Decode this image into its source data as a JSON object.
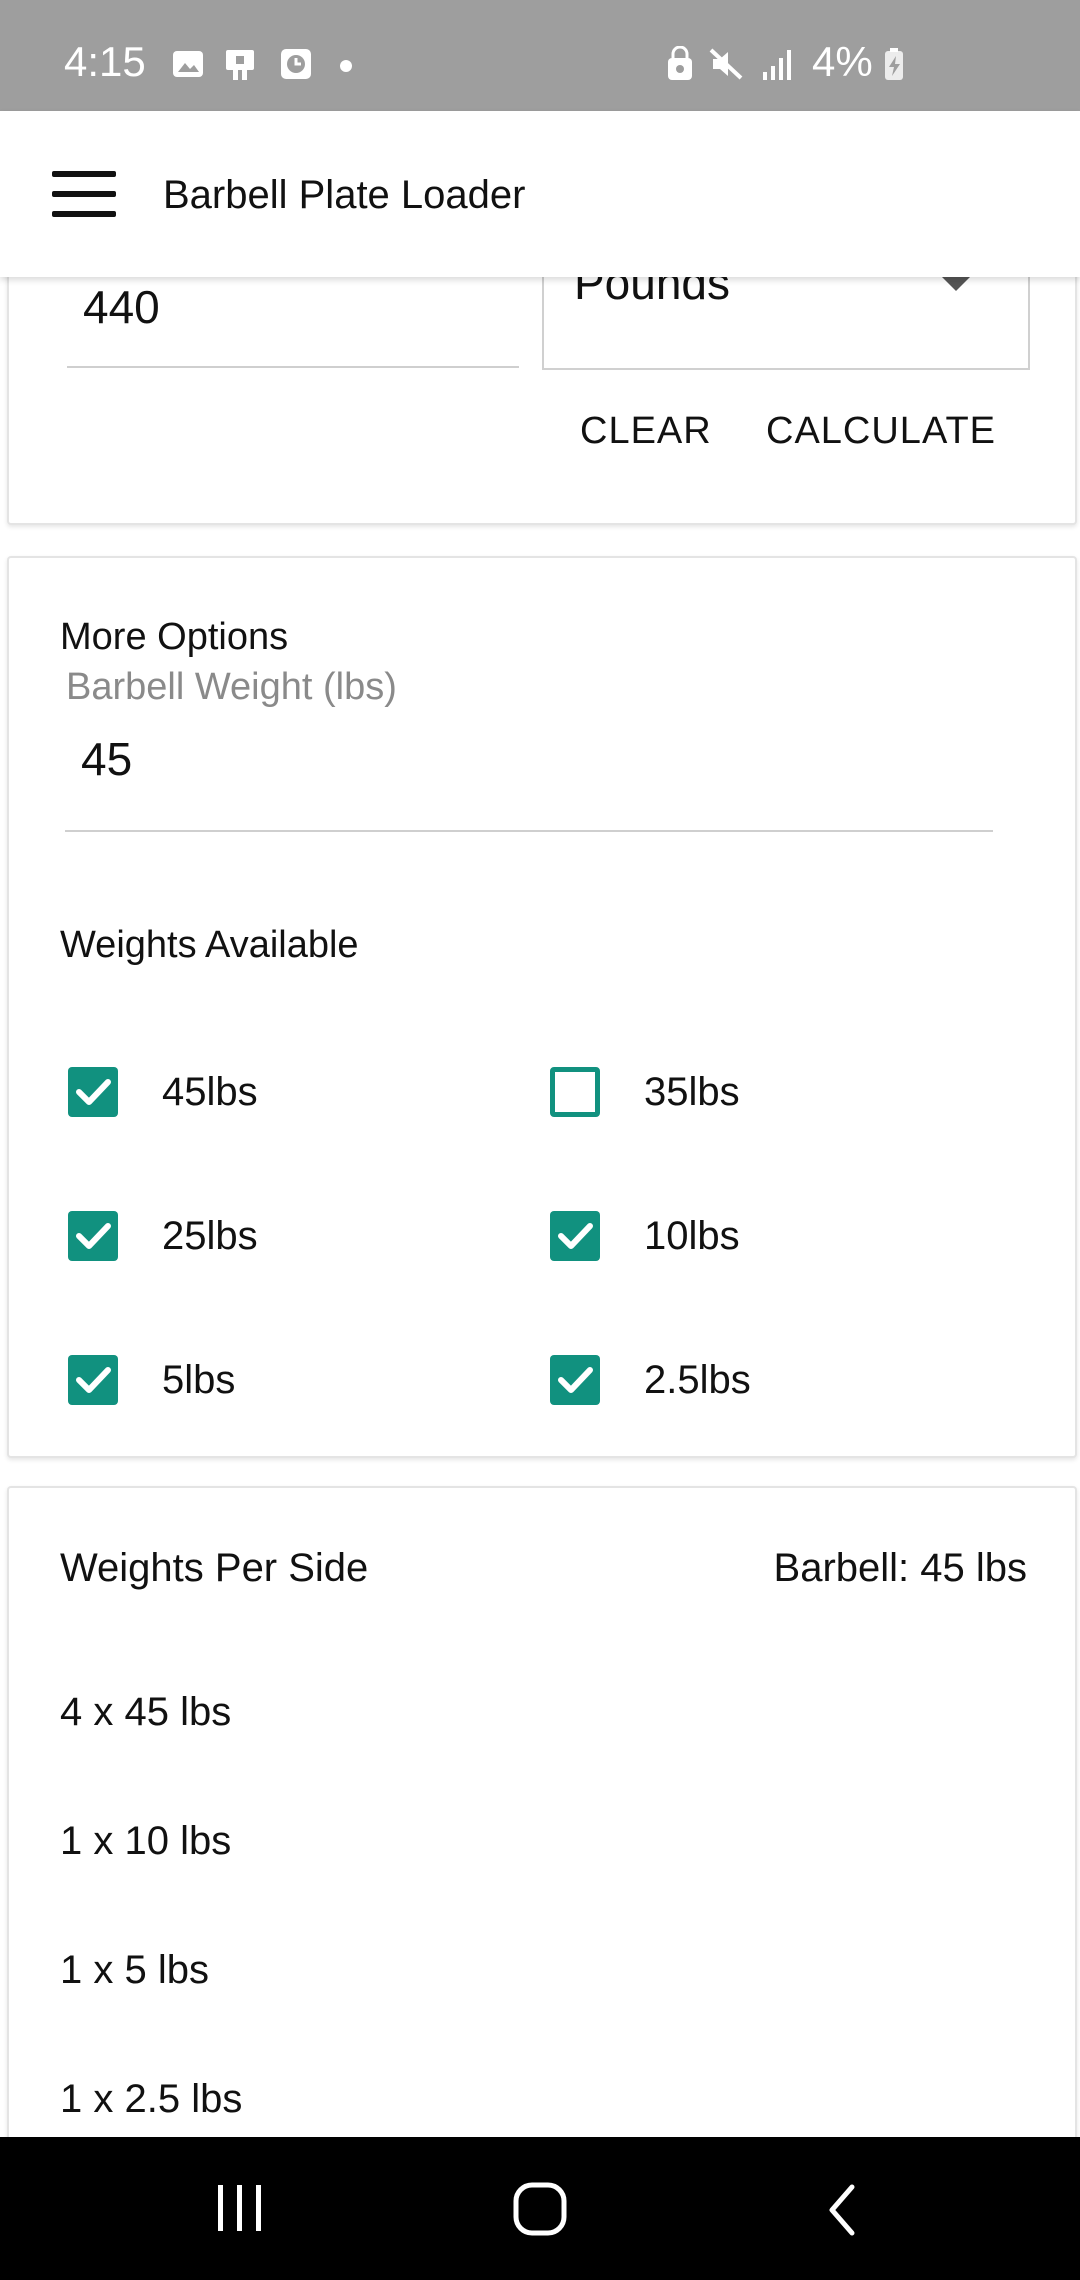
{
  "status_bar": {
    "time": "4:15",
    "battery_percent": "4%",
    "icons": [
      "gallery-icon",
      "device-icon",
      "clock-icon",
      "lock-icon",
      "mute-icon",
      "signal-icon",
      "battery-charging-icon"
    ]
  },
  "app_bar": {
    "title": "Barbell Plate Loader",
    "menu_icon": "hamburger-menu-icon"
  },
  "calculator": {
    "target_weight_value": "440",
    "unit_selected": "Pounds",
    "clear_label": "CLEAR",
    "calculate_label": "CALCULATE"
  },
  "options": {
    "heading": "More Options",
    "barbell_weight_label": "Barbell Weight (lbs)",
    "barbell_weight_value": "45",
    "weights_heading": "Weights Available",
    "weights": [
      {
        "label": "45lbs",
        "checked": true
      },
      {
        "label": "35lbs",
        "checked": false
      },
      {
        "label": "25lbs",
        "checked": true
      },
      {
        "label": "10lbs",
        "checked": true
      },
      {
        "label": "5lbs",
        "checked": true
      },
      {
        "label": "2.5lbs",
        "checked": true
      }
    ]
  },
  "results": {
    "heading": "Weights Per Side",
    "barbell_summary": "Barbell: 45 lbs",
    "plates": [
      "4 x 45 lbs",
      "1 x 10 lbs",
      "1 x 5 lbs",
      "1 x 2.5 lbs"
    ]
  },
  "colors": {
    "accent": "#11917f",
    "status_bar": "#9e9e9e",
    "nav_bar": "#000000"
  }
}
